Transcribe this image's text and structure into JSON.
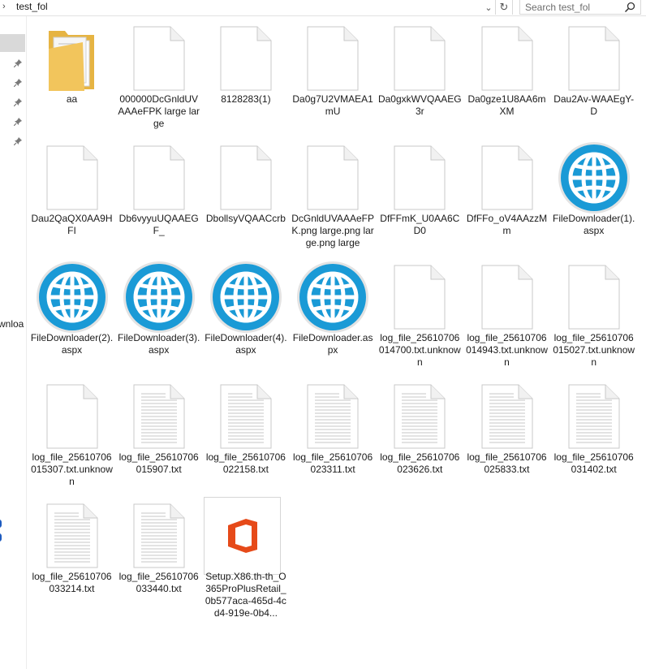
{
  "address": {
    "folder": "test_fol",
    "search_placeholder": "Search test_fol"
  },
  "nav": {
    "partial_label": "wnloa"
  },
  "files": [
    {
      "name": "aa",
      "type": "folder"
    },
    {
      "name": "000000DcGnldUVAAAeFPK large large",
      "type": "blank"
    },
    {
      "name": "8128283(1)",
      "type": "blank"
    },
    {
      "name": "Da0g7U2VMAEA1mU",
      "type": "blank"
    },
    {
      "name": "Da0gxkWVQAAEG3r",
      "type": "blank"
    },
    {
      "name": "Da0gze1U8AA6mXM",
      "type": "blank"
    },
    {
      "name": "Dau2Av-WAAEgY-D",
      "type": "blank"
    },
    {
      "name": "Dau2QaQX0AA9HFI",
      "type": "blank"
    },
    {
      "name": "Db6vyyuUQAAEGF_",
      "type": "blank"
    },
    {
      "name": "DbollsyVQAACcrb",
      "type": "blank"
    },
    {
      "name": "DcGnldUVAAAeFPK.png large.png large.png large",
      "type": "blank"
    },
    {
      "name": "DfFFmK_U0AA6CD0",
      "type": "blank"
    },
    {
      "name": "DfFFo_oV4AAzzMm",
      "type": "blank"
    },
    {
      "name": "FileDownloader(1).aspx",
      "type": "globe"
    },
    {
      "name": "FileDownloader(2).aspx",
      "type": "globe"
    },
    {
      "name": "FileDownloader(3).aspx",
      "type": "globe"
    },
    {
      "name": "FileDownloader(4).aspx",
      "type": "globe"
    },
    {
      "name": "FileDownloader.aspx",
      "type": "globe"
    },
    {
      "name": "log_file_25610706014700.txt.unknown",
      "type": "blank"
    },
    {
      "name": "log_file_25610706014943.txt.unknown",
      "type": "blank"
    },
    {
      "name": "log_file_25610706015027.txt.unknown",
      "type": "blank"
    },
    {
      "name": "log_file_25610706015307.txt.unknown",
      "type": "blank"
    },
    {
      "name": "log_file_25610706015907.txt",
      "type": "text"
    },
    {
      "name": "log_file_25610706022158.txt",
      "type": "text"
    },
    {
      "name": "log_file_25610706023311.txt",
      "type": "text"
    },
    {
      "name": "log_file_25610706023626.txt",
      "type": "text"
    },
    {
      "name": "log_file_25610706025833.txt",
      "type": "text"
    },
    {
      "name": "log_file_25610706031402.txt",
      "type": "text"
    },
    {
      "name": "log_file_25610706033214.txt",
      "type": "text"
    },
    {
      "name": "log_file_25610706033440.txt",
      "type": "text"
    },
    {
      "name": "Setup.X86.th-th_O365ProPlusRetail_0b577aca-465d-4cd4-919e-0b4...",
      "type": "office"
    }
  ],
  "colors": {
    "globe": "#1a9ad6",
    "office": "#e64a19",
    "folder": "#f2c55c"
  }
}
